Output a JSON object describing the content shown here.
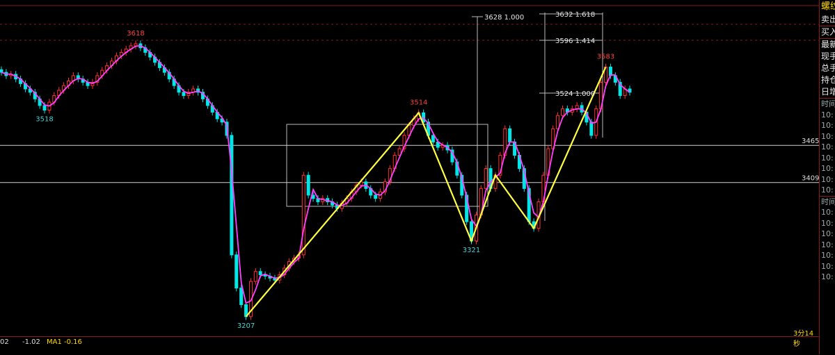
{
  "chart_data": {
    "type": "candlestick",
    "title": "",
    "ylim": [
      3190,
      3640
    ],
    "series": [
      {
        "values": [
          3575,
          3570,
          3572,
          3565,
          3558,
          3550,
          3545,
          3535,
          3525,
          3518,
          3530,
          3540,
          3548,
          3555,
          3562,
          3570,
          3565,
          3560,
          3555,
          3560,
          3570,
          3578,
          3585,
          3592,
          3600,
          3605,
          3610,
          3615,
          3618,
          3612,
          3605,
          3598,
          3590,
          3582,
          3575,
          3565,
          3555,
          3545,
          3540,
          3545,
          3550,
          3545,
          3535,
          3525,
          3515,
          3505,
          3500,
          3480,
          3300,
          3250,
          3225,
          3207,
          3260,
          3275,
          3270,
          3268,
          3265,
          3262,
          3270,
          3280,
          3290,
          3295,
          3300,
          3420,
          3390,
          3385,
          3380,
          3385,
          3380,
          3375,
          3370,
          3378,
          3385,
          3395,
          3405,
          3410,
          3400,
          3390,
          3385,
          3395,
          3410,
          3430,
          3450,
          3460,
          3480,
          3495,
          3505,
          3514,
          3500,
          3480,
          3470,
          3462,
          3465,
          3458,
          3440,
          3420,
          3390,
          3350,
          3321,
          3360,
          3400,
          3430,
          3400,
          3420,
          3450,
          3490,
          3470,
          3450,
          3430,
          3400,
          3350,
          3340,
          3380,
          3420,
          3460,
          3490,
          3510,
          3520,
          3515,
          3520,
          3525,
          3515,
          3500,
          3480,
          3520,
          3560,
          3583,
          3570,
          3560,
          3540,
          3550,
          3545
        ]
      }
    ],
    "price_labels": [
      {
        "label": "3618",
        "value": 3618,
        "color": "#ff4040"
      },
      {
        "label": "3518",
        "value": 3518,
        "color": "#40d0d0"
      },
      {
        "label": "3207",
        "value": 3207,
        "color": "#40d0d0"
      },
      {
        "label": "3514",
        "value": 3514,
        "color": "#ff4040"
      },
      {
        "label": "3321",
        "value": 3321,
        "color": "#40d0d0"
      },
      {
        "label": "3583",
        "value": 3583,
        "color": "#ff4040"
      }
    ],
    "horizontal_levels": [
      {
        "label": "3465",
        "value": 3465
      },
      {
        "label": "3409",
        "value": 3409
      }
    ],
    "fib_labels": [
      {
        "price": "3628",
        "ratio": "1.000"
      },
      {
        "price": "3632",
        "ratio": "1.618"
      },
      {
        "price": "3596",
        "ratio": "1.414"
      },
      {
        "price": "3524",
        "ratio": "1.000"
      }
    ],
    "colors": {
      "up": "#ff3030",
      "down": "#00e5e5",
      "ma": "#ff40ff",
      "zigzag": "#ffff40",
      "level": "#cfcfcf",
      "grid": "#8b1a1a"
    }
  },
  "right_panel": {
    "title": "螺纹",
    "items": [
      "卖出",
      "买入",
      "最新",
      "现手",
      "总手",
      "持仓",
      "日增"
    ],
    "time_label": "时间",
    "times": [
      "10:",
      "10:",
      "10:",
      "10:",
      "10:",
      "10:",
      "10:",
      "10:",
      "10:"
    ],
    "times2": [
      "时间",
      "10:",
      "10:",
      "10:",
      "10:",
      "10:",
      "10:",
      "10:",
      "10:"
    ]
  },
  "bottom_bar": {
    "val1": "02",
    "val2": "-1.02",
    "ma_label": "MA1 -0.16",
    "timer": "3分14秒"
  }
}
